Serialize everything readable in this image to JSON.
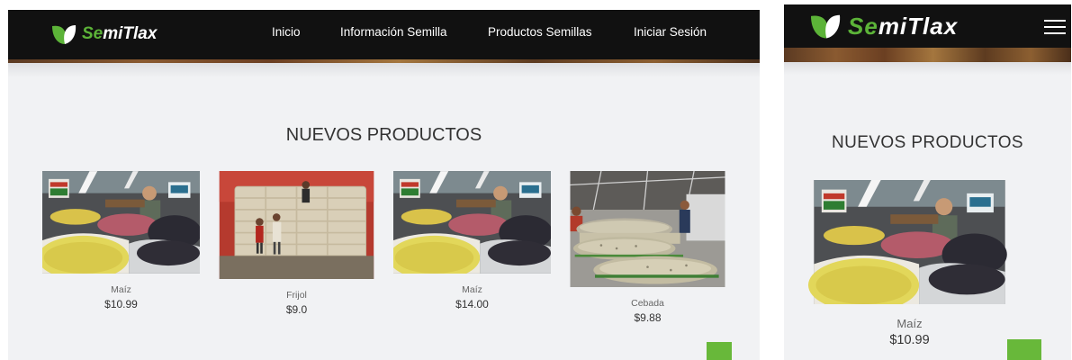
{
  "brand": {
    "part1": "Se",
    "part2": "miTlax",
    "icon": "leaf-logo-icon"
  },
  "nav": {
    "items": [
      {
        "label": "Inicio"
      },
      {
        "label": "Información Semilla"
      },
      {
        "label": "Productos Semillas"
      },
      {
        "label": "Iniciar Sesión"
      }
    ],
    "menu_icon": "hamburger-menu-icon"
  },
  "section": {
    "title": "NUEVOS PRODUCTOS"
  },
  "products": [
    {
      "name": "Maíz",
      "price": "$10.99",
      "image": "market-seed-stall-photo"
    },
    {
      "name": "Frijol",
      "price": "$9.0",
      "image": "stacked-sacks-warehouse-photo"
    },
    {
      "name": "Maíz",
      "price": "$14.00",
      "image": "market-seed-stall-photo"
    },
    {
      "name": "Cebada",
      "price": "$9.88",
      "image": "grain-sacks-market-photo"
    }
  ],
  "mobile_product": {
    "name": "Maíz",
    "price": "$10.99",
    "image": "market-seed-stall-photo"
  },
  "colors": {
    "navbar": "#111111",
    "brand_green": "#5cb338",
    "button_green": "#68b83a",
    "page_bg": "#f1f2f4"
  },
  "scroll_top": {
    "icon": "scroll-to-top-icon"
  }
}
